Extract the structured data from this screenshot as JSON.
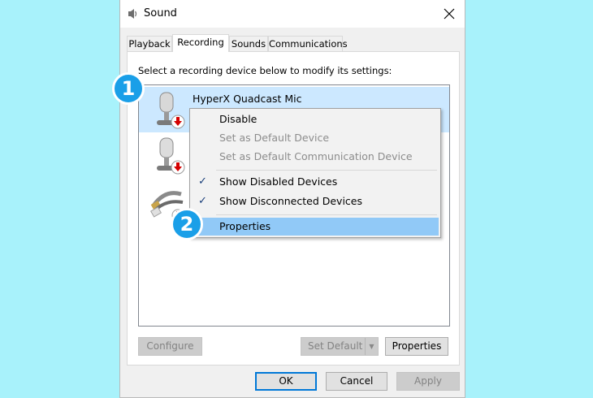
{
  "window": {
    "title": "Sound",
    "title_icon": "speaker-icon",
    "close_icon": "close-icon"
  },
  "tabs": [
    {
      "label": "Playback",
      "active": false
    },
    {
      "label": "Recording",
      "active": true
    },
    {
      "label": "Sounds",
      "active": false
    },
    {
      "label": "Communications",
      "active": false
    }
  ],
  "instruction": "Select a recording device below to modify its settings:",
  "devices": [
    {
      "name": "HyperX Quadcast Mic",
      "icon": "microphone-icon",
      "status_icon": "down-arrow-icon",
      "selected": true
    },
    {
      "name": "",
      "icon": "microphone-icon",
      "status_icon": "down-arrow-icon",
      "selected": false
    },
    {
      "name": "",
      "icon": "line-in-cable-icon",
      "status_icon": "down-arrow-icon",
      "selected": false
    }
  ],
  "context_menu": {
    "items": [
      {
        "label": "Disable",
        "enabled": true,
        "checked": false
      },
      {
        "label": "Set as Default Device",
        "enabled": false,
        "checked": false
      },
      {
        "label": "Set as Default Communication Device",
        "enabled": false,
        "checked": false
      },
      {
        "label": "Show Disabled Devices",
        "enabled": true,
        "checked": true
      },
      {
        "label": "Show Disconnected Devices",
        "enabled": true,
        "checked": true
      },
      {
        "label": "Properties",
        "enabled": true,
        "checked": false,
        "highlighted": true
      }
    ],
    "check_glyph": "✓"
  },
  "buttons": {
    "configure": "Configure",
    "set_default": "Set Default",
    "properties": "Properties",
    "ok": "OK",
    "cancel": "Cancel",
    "apply": "Apply"
  },
  "badges": [
    "1",
    "2"
  ],
  "colors": {
    "background": "#a8f2fb",
    "badge": "#1a9fe8",
    "selection": "#cce8ff",
    "menu_highlight": "#91c9f7"
  }
}
